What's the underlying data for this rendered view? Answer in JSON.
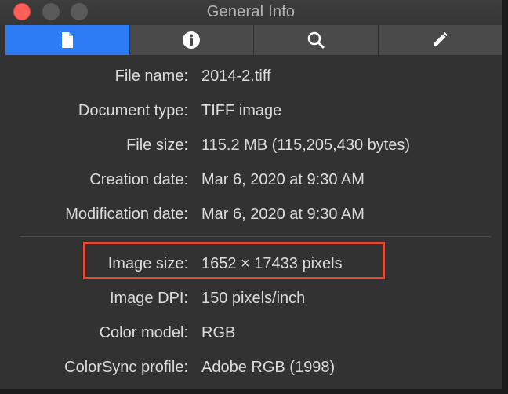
{
  "window": {
    "title": "General Info"
  },
  "tabs": [
    {
      "icon": "document-icon",
      "active": true
    },
    {
      "icon": "info-icon",
      "active": false
    },
    {
      "icon": "search-icon",
      "active": false
    },
    {
      "icon": "pencil-icon",
      "active": false
    }
  ],
  "general": [
    {
      "label": "File name:",
      "value": "2014-2.tiff"
    },
    {
      "label": "Document type:",
      "value": "TIFF image"
    },
    {
      "label": "File size:",
      "value": "115.2 MB (115,205,430 bytes)"
    },
    {
      "label": "Creation date:",
      "value": "Mar 6, 2020 at 9:30 AM"
    },
    {
      "label": "Modification date:",
      "value": "Mar 6, 2020 at 9:30 AM"
    }
  ],
  "image": [
    {
      "label": "Image size:",
      "value": "1652 × 17433 pixels"
    },
    {
      "label": "Image DPI:",
      "value": "150 pixels/inch"
    },
    {
      "label": "Color model:",
      "value": "RGB"
    },
    {
      "label": "ColorSync profile:",
      "value": "Adobe RGB (1998)"
    }
  ],
  "colors": {
    "accent": "#2d7cf5",
    "highlight_box": "#e44a35",
    "close_button": "#fe5f57"
  }
}
